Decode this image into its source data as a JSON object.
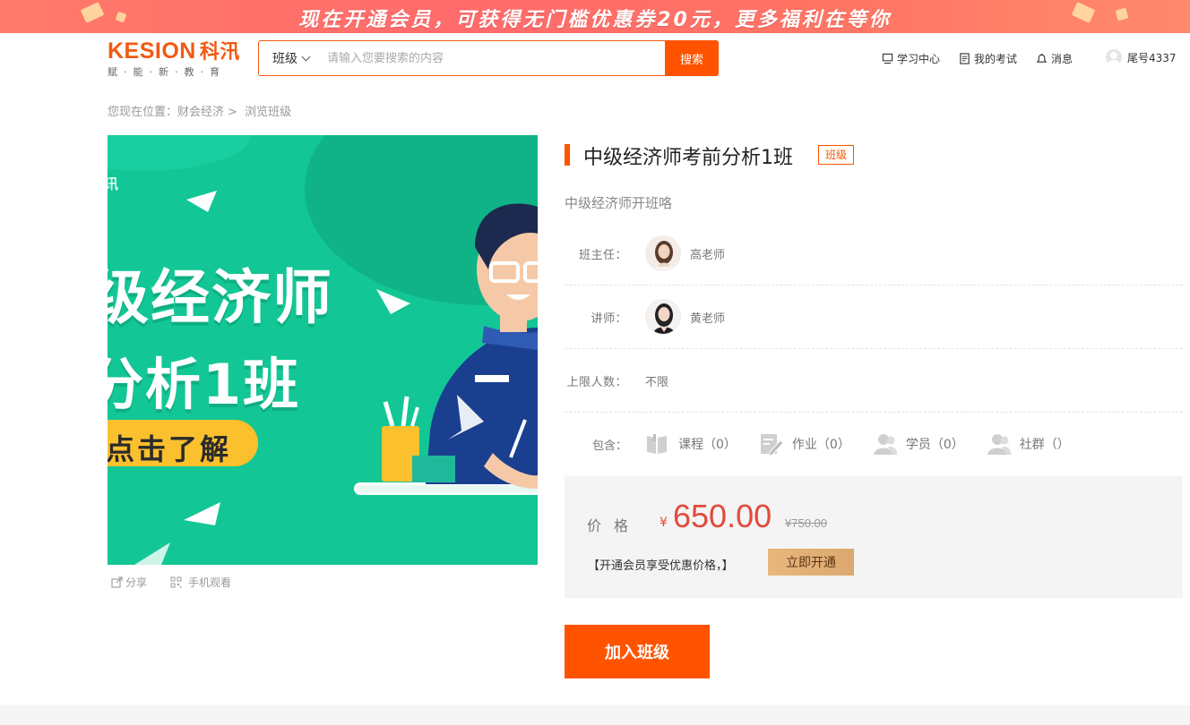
{
  "promo": {
    "text": "现在开通会员，可获得无门槛优惠券20元，更多福利在等你"
  },
  "logo": {
    "brand": "KESION",
    "brand_cn": "科汛",
    "slogan": "赋·能·新·教·育"
  },
  "search": {
    "category": "班级",
    "placeholder": "请输入您要搜索的内容",
    "value": "",
    "button": "搜索"
  },
  "nav": {
    "learning_center": "学习中心",
    "my_exams": "我的考试",
    "messages": "消息",
    "username": "尾号4337"
  },
  "breadcrumb": {
    "prefix": "您现在位置：",
    "category": "财会经济",
    "separator": ">",
    "current": "浏览班级"
  },
  "cover": {
    "line1": "级经济师",
    "line2": "分析1班",
    "cta": "点击了解",
    "share": "分享",
    "mobile": "手机观看"
  },
  "klass": {
    "title": "中级经济师考前分析1班",
    "tag": "班级",
    "subtitle": "中级经济师开班咯",
    "head_teacher_label": "班主任：",
    "head_teacher": "高老师",
    "lecturer_label": "讲师：",
    "lecturer": "黄老师",
    "capacity_label": "上限人数：",
    "capacity": "不限",
    "includes_label": "包含：",
    "includes": [
      {
        "label": "课程（0）",
        "icon": "book-icon"
      },
      {
        "label": "作业（0）",
        "icon": "homework-icon"
      },
      {
        "label": "学员（0）",
        "icon": "students-icon"
      },
      {
        "label": "社群（）",
        "icon": "community-icon"
      }
    ]
  },
  "price": {
    "label": "价格",
    "currency": "¥",
    "current": "650.00",
    "original": "¥750.00",
    "vip_note": "【开通会员享受优惠价格，】",
    "vip_button": "立即开通"
  },
  "join_button": "加入班级",
  "colors": {
    "accent": "#ff5300",
    "price": "#e24a3b",
    "cover_green": "#12c795"
  }
}
